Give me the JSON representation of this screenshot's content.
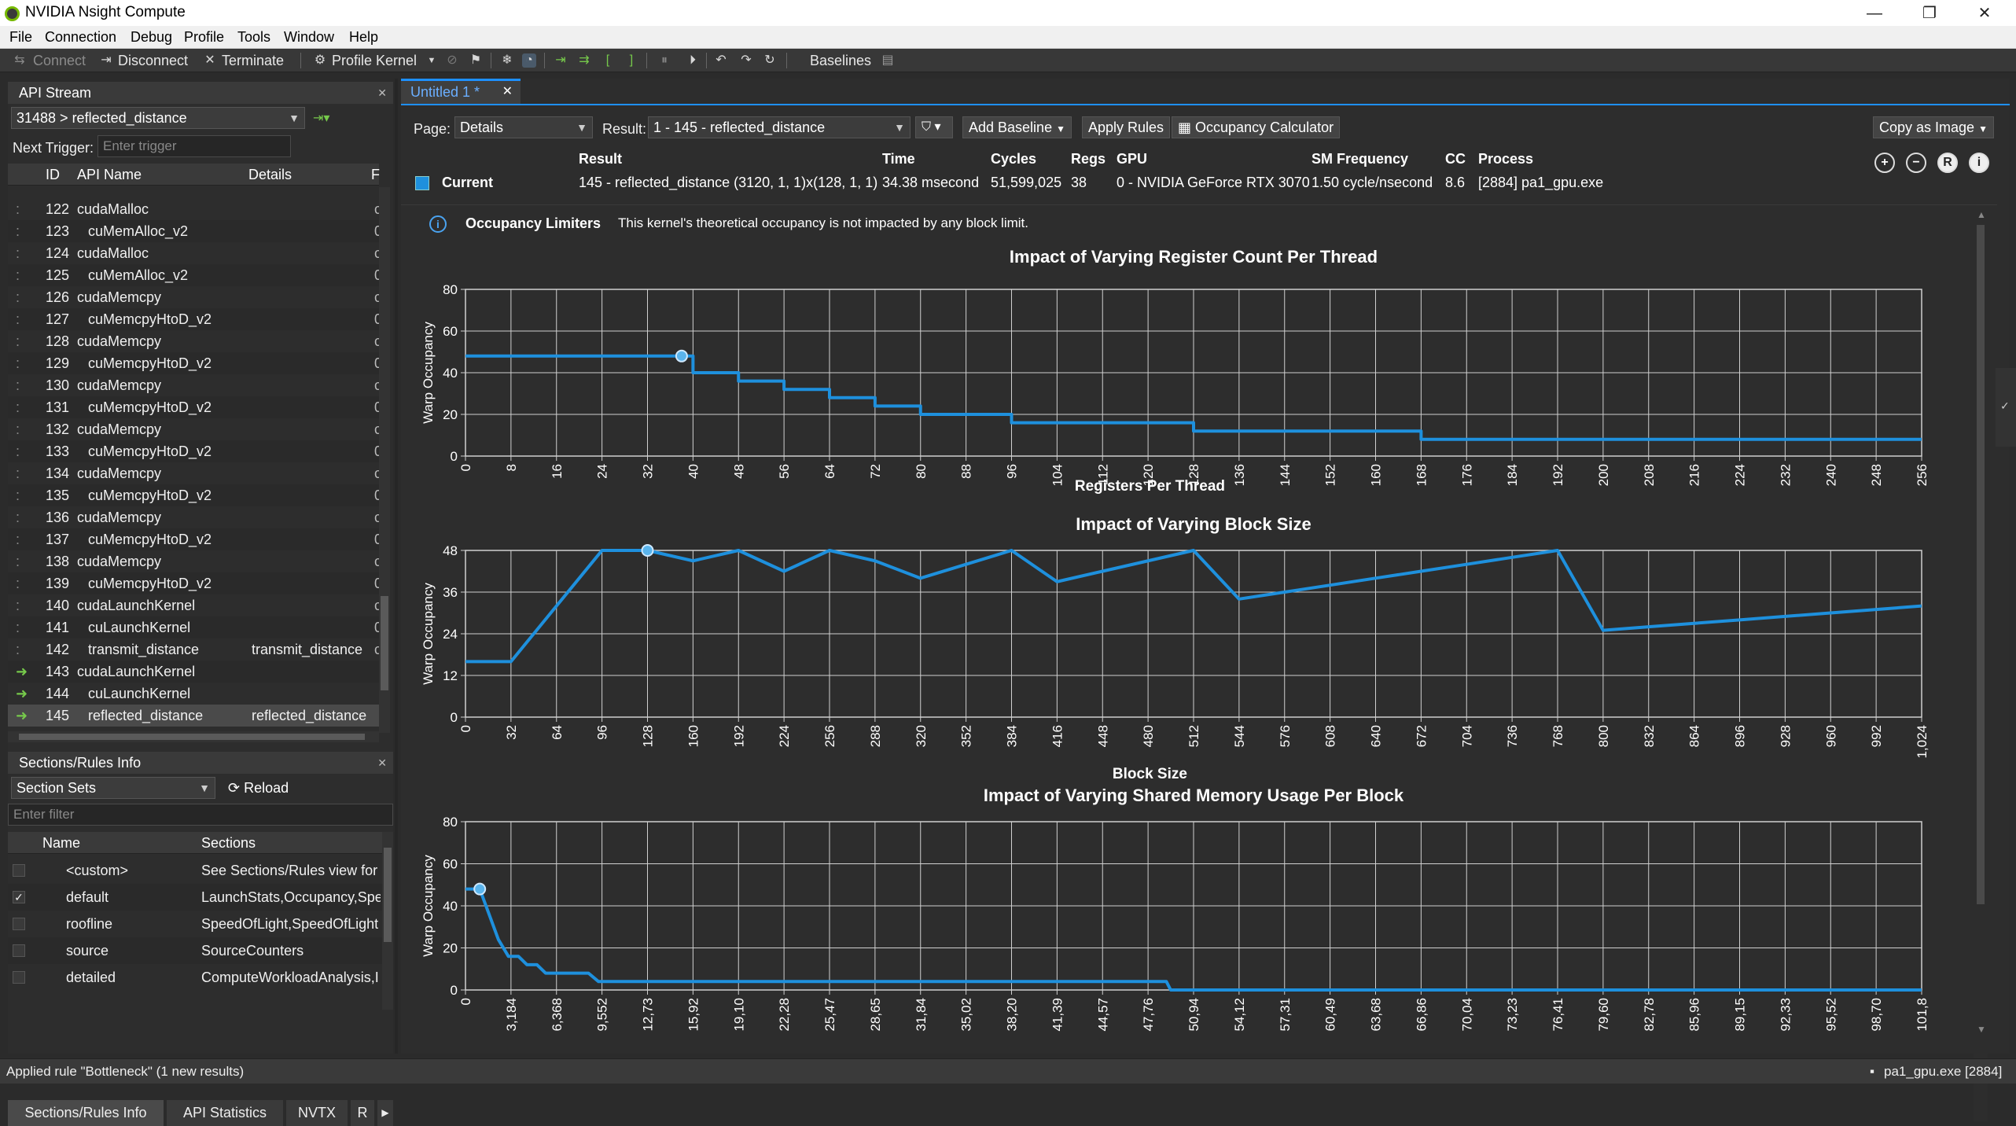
{
  "window": {
    "title": "NVIDIA Nsight Compute",
    "controls": [
      "—",
      "❐",
      "✕"
    ]
  },
  "menu": [
    "File",
    "Connection",
    "Debug",
    "Profile",
    "Tools",
    "Window",
    "Help"
  ],
  "toolbar": {
    "connect": "Connect",
    "disconnect": "Disconnect",
    "terminate": "Terminate",
    "profile_kernel": "Profile Kernel",
    "baselines": "Baselines"
  },
  "api_stream": {
    "title": "API Stream",
    "selector": "31488 > reflected_distance",
    "next_trigger_label": "Next Trigger:",
    "next_trigger_placeholder": "Enter trigger",
    "columns": [
      "ID",
      "API Name",
      "Details",
      "F"
    ],
    "rows": [
      {
        "id": "122",
        "name": "cudaMalloc",
        "details": "",
        "f": "c",
        "indent": false,
        "arrow": false
      },
      {
        "id": "123",
        "name": "cuMemAlloc_v2",
        "details": "",
        "f": "0",
        "indent": true,
        "arrow": false
      },
      {
        "id": "124",
        "name": "cudaMalloc",
        "details": "",
        "f": "c",
        "indent": false,
        "arrow": false
      },
      {
        "id": "125",
        "name": "cuMemAlloc_v2",
        "details": "",
        "f": "0",
        "indent": true,
        "arrow": false
      },
      {
        "id": "126",
        "name": "cudaMemcpy",
        "details": "",
        "f": "c",
        "indent": false,
        "arrow": false
      },
      {
        "id": "127",
        "name": "cuMemcpyHtoD_v2",
        "details": "",
        "f": "0",
        "indent": true,
        "arrow": false
      },
      {
        "id": "128",
        "name": "cudaMemcpy",
        "details": "",
        "f": "c",
        "indent": false,
        "arrow": false
      },
      {
        "id": "129",
        "name": "cuMemcpyHtoD_v2",
        "details": "",
        "f": "0",
        "indent": true,
        "arrow": false
      },
      {
        "id": "130",
        "name": "cudaMemcpy",
        "details": "",
        "f": "c",
        "indent": false,
        "arrow": false
      },
      {
        "id": "131",
        "name": "cuMemcpyHtoD_v2",
        "details": "",
        "f": "0",
        "indent": true,
        "arrow": false
      },
      {
        "id": "132",
        "name": "cudaMemcpy",
        "details": "",
        "f": "c",
        "indent": false,
        "arrow": false
      },
      {
        "id": "133",
        "name": "cuMemcpyHtoD_v2",
        "details": "",
        "f": "0",
        "indent": true,
        "arrow": false
      },
      {
        "id": "134",
        "name": "cudaMemcpy",
        "details": "",
        "f": "c",
        "indent": false,
        "arrow": false
      },
      {
        "id": "135",
        "name": "cuMemcpyHtoD_v2",
        "details": "",
        "f": "0",
        "indent": true,
        "arrow": false
      },
      {
        "id": "136",
        "name": "cudaMemcpy",
        "details": "",
        "f": "c",
        "indent": false,
        "arrow": false
      },
      {
        "id": "137",
        "name": "cuMemcpyHtoD_v2",
        "details": "",
        "f": "0",
        "indent": true,
        "arrow": false
      },
      {
        "id": "138",
        "name": "cudaMemcpy",
        "details": "",
        "f": "c",
        "indent": false,
        "arrow": false
      },
      {
        "id": "139",
        "name": "cuMemcpyHtoD_v2",
        "details": "",
        "f": "0",
        "indent": true,
        "arrow": false
      },
      {
        "id": "140",
        "name": "cudaLaunchKernel",
        "details": "",
        "f": "c",
        "indent": false,
        "arrow": false
      },
      {
        "id": "141",
        "name": "cuLaunchKernel",
        "details": "",
        "f": "0",
        "indent": true,
        "arrow": false
      },
      {
        "id": "142",
        "name": "transmit_distance",
        "details": "transmit_distance",
        "f": "c",
        "indent": true,
        "arrow": false
      },
      {
        "id": "143",
        "name": "cudaLaunchKernel",
        "details": "",
        "f": "",
        "indent": false,
        "arrow": true
      },
      {
        "id": "144",
        "name": "cuLaunchKernel",
        "details": "",
        "f": "",
        "indent": true,
        "arrow": true
      },
      {
        "id": "145",
        "name": "reflected_distance",
        "details": "reflected_distance",
        "f": "",
        "indent": true,
        "arrow": true
      }
    ]
  },
  "sections": {
    "title": "Sections/Rules Info",
    "section_sets": "Section Sets",
    "reload": "Reload",
    "filter_placeholder": "Enter filter",
    "columns": [
      "Name",
      "Sections"
    ],
    "rows": [
      {
        "name": "<custom>",
        "sections": "See Sections/Rules view for",
        "checked": false
      },
      {
        "name": "default",
        "sections": "LaunchStats,Occupancy,Spe",
        "checked": true
      },
      {
        "name": "roofline",
        "sections": "SpeedOfLight,SpeedOfLight",
        "checked": false
      },
      {
        "name": "source",
        "sections": "SourceCounters",
        "checked": false
      },
      {
        "name": "detailed",
        "sections": "ComputeWorkloadAnalysis,I",
        "checked": false
      }
    ],
    "tabs": [
      "Sections/Rules Info",
      "API Statistics",
      "NVTX",
      "R"
    ]
  },
  "document": {
    "tab": "Untitled 1 *",
    "page_label": "Page:",
    "page_value": "Details",
    "result_label": "Result:",
    "result_value": "1 -   145 - reflected_distance",
    "add_baseline": "Add Baseline",
    "apply_rules": "Apply Rules",
    "occupancy_calc": "Occupancy Calculator",
    "copy_as_image": "Copy as Image",
    "headers": {
      "result": "Result",
      "time": "Time",
      "cycles": "Cycles",
      "regs": "Regs",
      "gpu": "GPU",
      "sm_freq": "SM Frequency",
      "cc": "CC",
      "process": "Process"
    },
    "current": {
      "label": "Current",
      "result": "145 - reflected_distance (3120, 1, 1)x(128, 1, 1)",
      "time": "34.38 msecond",
      "cycles": "51,599,025",
      "regs": "38",
      "gpu": "0 - NVIDIA GeForce RTX 3070",
      "sm_freq": "1.50 cycle/nsecond",
      "cc": "8.6",
      "process": "[2884] pa1_gpu.exe"
    },
    "occupancy_label": "Occupancy Limiters",
    "occupancy_text": "This kernel's theoretical occupancy is not impacted by any block limit."
  },
  "colors": {
    "line": "#1e90dd",
    "accent": "#6aaeff"
  },
  "chart_data": [
    {
      "type": "line",
      "title": "Impact of Varying Register Count Per Thread",
      "xlabel": "Registers Per Thread",
      "ylabel": "Warp Occupancy",
      "xlim": [
        0,
        256
      ],
      "ylim": [
        0,
        80
      ],
      "yticks": [
        0,
        20,
        40,
        60,
        80
      ],
      "xticks": [
        "0",
        "8",
        "16",
        "24",
        "32",
        "40",
        "48",
        "56",
        "64",
        "72",
        "80",
        "88",
        "96",
        "104",
        "112",
        "120",
        "128",
        "136",
        "144",
        "152",
        "160",
        "168",
        "176",
        "184",
        "192",
        "200",
        "208",
        "216",
        "224",
        "232",
        "240",
        "248",
        "256"
      ],
      "x": [
        0,
        40,
        40,
        48,
        48,
        56,
        56,
        64,
        64,
        72,
        72,
        80,
        80,
        96,
        96,
        128,
        128,
        168,
        168,
        256
      ],
      "y": [
        48,
        48,
        40,
        40,
        36,
        36,
        32,
        32,
        28,
        28,
        24,
        24,
        20,
        20,
        16,
        16,
        12,
        12,
        8,
        8
      ],
      "marker": {
        "x": 38,
        "y": 48
      }
    },
    {
      "type": "line",
      "title": "Impact of Varying Block Size",
      "xlabel": "Block Size",
      "ylabel": "Warp Occupancy",
      "xlim": [
        0,
        1024
      ],
      "ylim": [
        0,
        48
      ],
      "yticks": [
        0,
        12,
        24,
        36,
        48
      ],
      "xticks": [
        "0",
        "32",
        "64",
        "96",
        "128",
        "160",
        "192",
        "224",
        "256",
        "288",
        "320",
        "352",
        "384",
        "416",
        "448",
        "480",
        "512",
        "544",
        "576",
        "608",
        "640",
        "672",
        "704",
        "736",
        "768",
        "800",
        "832",
        "864",
        "896",
        "928",
        "960",
        "992",
        "1,024"
      ],
      "x": [
        0,
        32,
        64,
        96,
        128,
        160,
        192,
        224,
        256,
        288,
        320,
        352,
        384,
        416,
        448,
        480,
        512,
        544,
        576,
        608,
        640,
        672,
        704,
        736,
        768,
        800,
        832,
        864,
        896,
        928,
        960,
        992,
        1024
      ],
      "y": [
        16,
        16,
        32,
        48,
        48,
        45,
        48,
        42,
        48,
        45,
        40,
        44,
        48,
        39,
        42,
        45,
        48,
        34,
        36,
        38,
        40,
        42,
        44,
        46,
        48,
        25,
        26,
        27,
        28,
        29,
        30,
        31,
        32
      ],
      "marker": {
        "x": 128,
        "y": 48
      }
    },
    {
      "type": "line",
      "title": "Impact of Varying Shared Memory Usage Per Block",
      "xlabel": "",
      "ylabel": "Warp Occupancy",
      "xlim": [
        0,
        101800
      ],
      "ylim": [
        0,
        80
      ],
      "yticks": [
        0,
        20,
        40,
        60,
        80
      ],
      "xticks": [
        "0",
        "3,184",
        "6,368",
        "9,552",
        "12,73",
        "15,92",
        "19,10",
        "22,28",
        "25,47",
        "28,65",
        "31,84",
        "35,02",
        "38,20",
        "41,39",
        "44,57",
        "47,76",
        "50,94",
        "54,12",
        "57,31",
        "60,49",
        "63,68",
        "66,86",
        "70,04",
        "73,23",
        "76,41",
        "79,60",
        "82,78",
        "85,96",
        "89,15",
        "92,33",
        "95,52",
        "98,70",
        "101,8"
      ],
      "x": [
        0,
        1000,
        2300,
        3000,
        3700,
        4300,
        5000,
        5600,
        6200,
        8600,
        9300,
        49000,
        49300,
        101800
      ],
      "y": [
        48,
        48,
        24,
        16,
        16,
        12,
        12,
        8,
        8,
        8,
        4,
        4,
        0,
        0
      ],
      "marker": {
        "x": 1000,
        "y": 48
      }
    }
  ],
  "status": {
    "left": "Applied rule \"Bottleneck\" (1 new results)",
    "right": "pa1_gpu.exe [2884]"
  }
}
